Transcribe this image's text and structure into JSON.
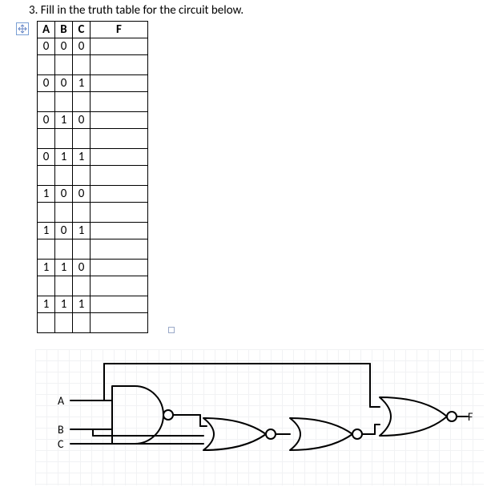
{
  "prompt": "3. Fill in the truth table for the circuit below.",
  "anchor_icon": "move-anchor-icon",
  "truth_table": {
    "headers": {
      "A": "A",
      "B": "B",
      "C": "C",
      "F": "F"
    },
    "rows": [
      {
        "A": "0",
        "B": "0",
        "C": "0",
        "F": ""
      },
      {
        "A": "0",
        "B": "0",
        "C": "1",
        "F": ""
      },
      {
        "A": "0",
        "B": "1",
        "C": "0",
        "F": ""
      },
      {
        "A": "0",
        "B": "1",
        "C": "1",
        "F": ""
      },
      {
        "A": "1",
        "B": "0",
        "C": "0",
        "F": ""
      },
      {
        "A": "1",
        "B": "0",
        "C": "1",
        "F": ""
      },
      {
        "A": "1",
        "B": "1",
        "C": "0",
        "F": ""
      },
      {
        "A": "1",
        "B": "1",
        "C": "1",
        "F": ""
      }
    ]
  },
  "circuit": {
    "inputs": {
      "A": "A",
      "B": "B",
      "C": "C"
    },
    "output": "F",
    "gates": [
      "NAND(A,B)",
      "NOR(B,C)",
      "NOR(NAND,NOR)",
      "NOR(A_branch, prev)"
    ]
  }
}
